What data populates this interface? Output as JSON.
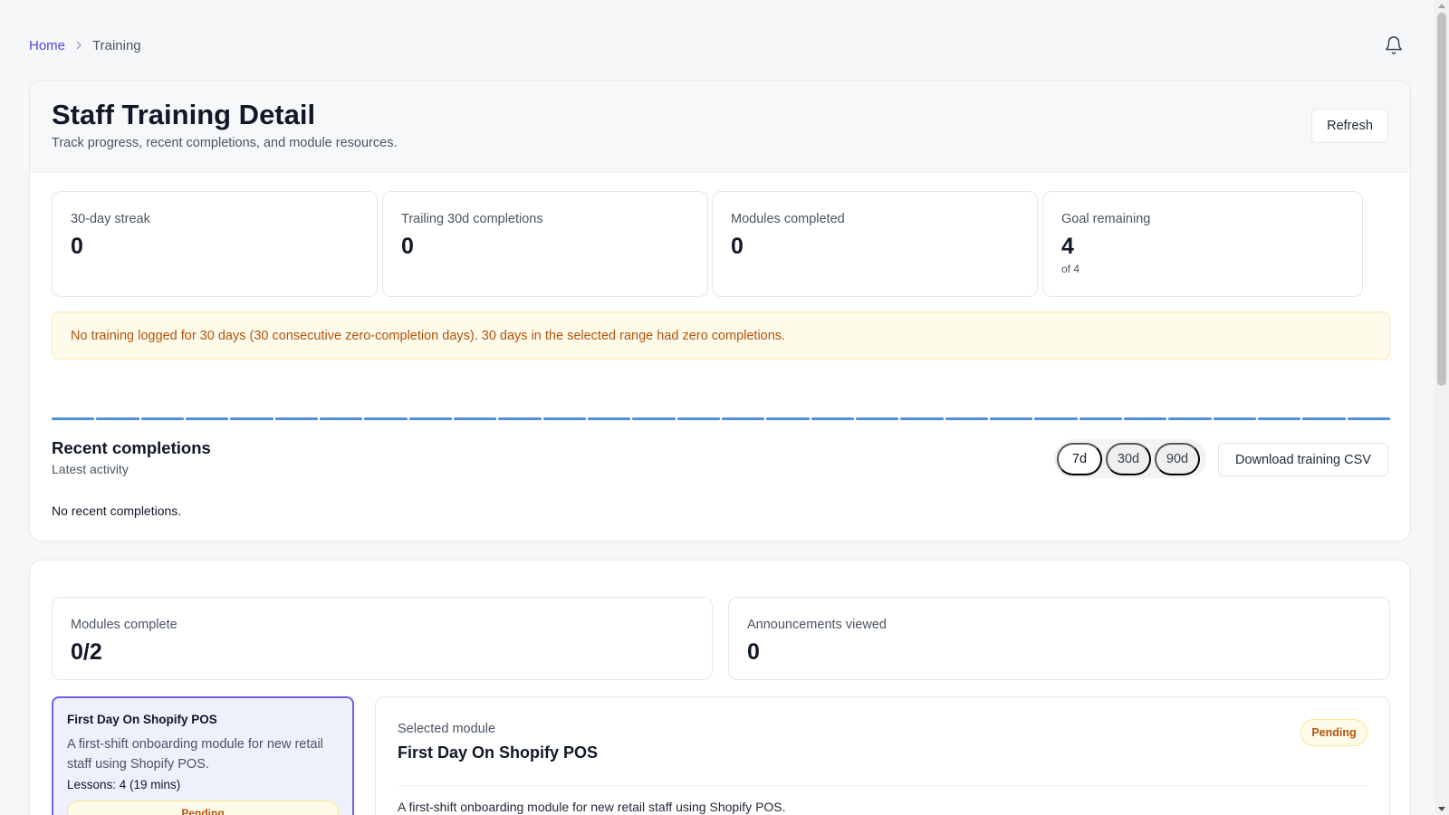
{
  "breadcrumb": {
    "home": "Home",
    "current": "Training"
  },
  "header": {
    "title": "Staff Training Detail",
    "subtitle": "Track progress, recent completions, and module resources.",
    "refresh_label": "Refresh"
  },
  "stats": [
    {
      "label": "30-day streak",
      "value": "0",
      "sub": ""
    },
    {
      "label": "Trailing 30d completions",
      "value": "0",
      "sub": ""
    },
    {
      "label": "Modules completed",
      "value": "0",
      "sub": ""
    },
    {
      "label": "Goal remaining",
      "value": "4",
      "sub": "of 4"
    }
  ],
  "alert": {
    "text": "No training logged for 30 days (30 consecutive zero-completion days). 30 days in the selected range had zero completions."
  },
  "activity_bars": {
    "count": 30,
    "color": "#4f8fdb"
  },
  "recent": {
    "title": "Recent completions",
    "subtitle": "Latest activity",
    "ranges": [
      "7d",
      "30d",
      "90d"
    ],
    "active_range": "7d",
    "download_label": "Download training CSV",
    "empty_text": "No recent completions."
  },
  "modules_summary": {
    "complete_label": "Modules complete",
    "complete_value": "0/2",
    "announcements_label": "Announcements viewed",
    "announcements_value": "0"
  },
  "module_list": [
    {
      "title": "First Day On Shopify POS",
      "description": "A first-shift onboarding module for new retail staff using Shopify POS.",
      "lessons": "Lessons: 4 (19 mins)",
      "status": "Pending"
    }
  ],
  "selected_module": {
    "label": "Selected module",
    "title": "First Day On Shopify POS",
    "status": "Pending",
    "description": "A first-shift onboarding module for new retail staff using Shopify POS."
  },
  "colors": {
    "accent": "#4f46e5",
    "warning_text": "#b45309",
    "warning_bg": "#fefbeb",
    "selected_border": "#6d62e8"
  }
}
